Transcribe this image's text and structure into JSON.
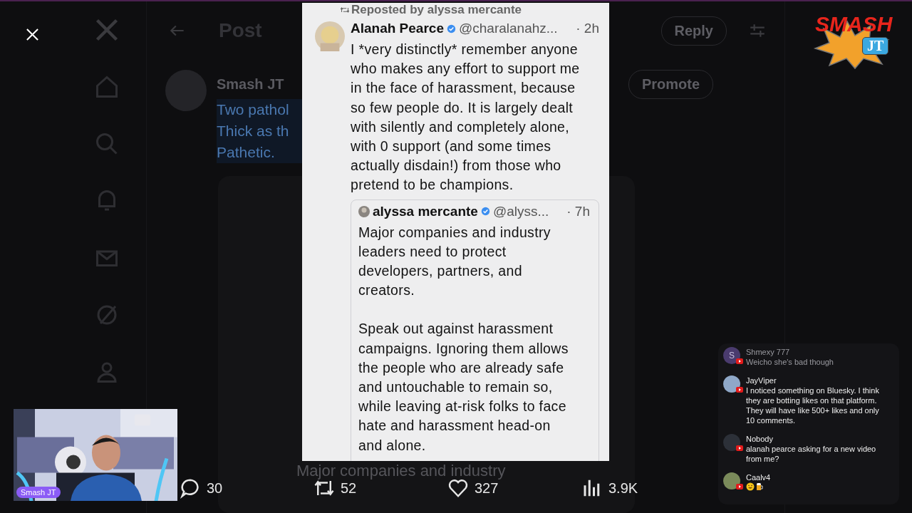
{
  "background_page": {
    "header_title": "Post",
    "reply_button": "Reply",
    "promote_button": "Promote",
    "author": "Smash JT",
    "post_lines": [
      "Two pathol",
      "Thick as th",
      "Pathetic."
    ],
    "quote_fragment": "Major companies and industry",
    "stats": [
      {
        "kind": "reply",
        "count": "30"
      },
      {
        "kind": "repost",
        "count": "52"
      },
      {
        "kind": "like",
        "count": "327"
      },
      {
        "kind": "views",
        "count": "3.9K"
      }
    ]
  },
  "screenshot": {
    "repost_label": "Reposted by alyssa mercante",
    "author": {
      "name": "Alanah Pearce",
      "verified": true,
      "handle": "@charalanahz...",
      "time": "· 2h"
    },
    "text": "I *very distinctly* remember anyone who makes any effort to support me in the face of harassment, because so few people do. It is largely dealt with silently and completely alone, with 0 support (and some times actually disdain!) from those who pretend to be champions.",
    "quote": {
      "name": "alyssa mercante",
      "verified": true,
      "handle": "@alyss...",
      "time": "· 7h",
      "paragraphs": [
        "Major companies and industry leaders need to protect developers, partners, and creators.",
        "Speak out against harassment campaigns. Ignoring them allows the people who are already safe and untouchable to remain so, while leaving at-risk folks to face hate and harassment head-on and alone."
      ]
    }
  },
  "webcam": {
    "kind": "picture",
    "label": "Smash JT"
  },
  "logo": {
    "top": "SMASH",
    "bottom": "JT"
  },
  "chat": [
    {
      "name": "Shmexy 777",
      "message": "Weicho she's bad though",
      "avatar_letter": "S",
      "color": "#4a3b6e"
    },
    {
      "name": "JayViper",
      "message": "I noticed something on Bluesky. I think they are botting likes on that platform. They will have like 500+ likes and only 10 comments.",
      "color": "#8fa8c8"
    },
    {
      "name": "Nobody",
      "message": "alanah pearce asking for a new video from me?",
      "color": "#2c3038"
    },
    {
      "name": "Caalv4",
      "emojis": [
        {
          "kind": "laughing"
        },
        {
          "kind": "beer"
        }
      ],
      "color": "#7a8a5a"
    }
  ]
}
